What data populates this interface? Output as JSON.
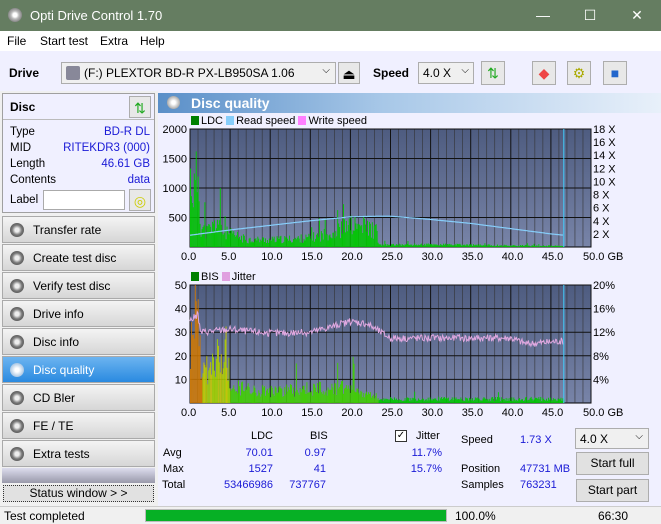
{
  "window": {
    "title": "Opti Drive Control 1.70",
    "minimize": "—",
    "maximize": "☐",
    "close": "✕"
  },
  "menu": [
    "File",
    "Start test",
    "Extra",
    "Help"
  ],
  "toolbar": {
    "drive_label": "Drive",
    "drive_value": "(F:)  PLEXTOR BD-R  PX-LB950SA 1.06",
    "speed_label": "Speed",
    "speed_value": "4.0 X"
  },
  "disc": {
    "title": "Disc",
    "type_label": "Type",
    "type": "BD-R DL",
    "mid_label": "MID",
    "mid": "RITEKDR3 (000)",
    "length_label": "Length",
    "length": "46.61 GB",
    "contents_label": "Contents",
    "contents": "data",
    "label_label": "Label",
    "label_value": ""
  },
  "nav": [
    {
      "label": "Transfer rate"
    },
    {
      "label": "Create test disc"
    },
    {
      "label": "Verify test disc"
    },
    {
      "label": "Drive info"
    },
    {
      "label": "Disc info"
    },
    {
      "label": "Disc quality",
      "active": true
    },
    {
      "label": "CD Bler"
    },
    {
      "label": "FE / TE"
    },
    {
      "label": "Extra tests"
    }
  ],
  "status_window": "Status window > >",
  "panel_title": "Disc quality",
  "chart_data": [
    {
      "type": "bar",
      "title": "LDC",
      "legend": [
        "LDC",
        "Read speed",
        "Write speed"
      ],
      "legend_colors": [
        "#008000",
        "#87cefa",
        "#ff80ff"
      ],
      "x_ticks": [
        "0.0",
        "5.0",
        "10.0",
        "15.0",
        "20.0",
        "25.0",
        "30.0",
        "35.0",
        "40.0",
        "45.0",
        "50.0 GB"
      ],
      "y_ticks": [
        "2000",
        "1500",
        "1000",
        "500"
      ],
      "y2_ticks": [
        "18 X",
        "16 X",
        "14 X",
        "12 X",
        "10 X",
        "8 X",
        "6 X",
        "4 X",
        "2 X"
      ],
      "xlim": [
        0,
        50
      ],
      "ylim": [
        0,
        2000
      ],
      "y2lim": [
        0,
        18
      ],
      "end_marker_gb": 46.61,
      "ldc_profile": [
        [
          0,
          1350
        ],
        [
          0.5,
          1100
        ],
        [
          1,
          1527
        ],
        [
          1.3,
          400
        ],
        [
          2,
          300
        ],
        [
          3,
          420
        ],
        [
          3.3,
          560
        ],
        [
          4,
          300
        ],
        [
          5,
          250
        ],
        [
          7,
          150
        ],
        [
          10,
          140
        ],
        [
          13,
          160
        ],
        [
          15,
          180
        ],
        [
          18,
          300
        ],
        [
          20,
          420
        ],
        [
          22,
          400
        ],
        [
          23.3,
          300
        ],
        [
          23.5,
          40
        ],
        [
          30,
          50
        ],
        [
          40,
          30
        ],
        [
          46.6,
          20
        ]
      ],
      "read_speed": [
        [
          0,
          1.8
        ],
        [
          5,
          2.6
        ],
        [
          10,
          3.3
        ],
        [
          15,
          4.0
        ],
        [
          20,
          4.6
        ],
        [
          23.5,
          4.7
        ],
        [
          25,
          4.7
        ],
        [
          30,
          4.2
        ],
        [
          35,
          3.6
        ],
        [
          40,
          2.8
        ],
        [
          45,
          2.0
        ],
        [
          46.6,
          1.8
        ]
      ]
    },
    {
      "type": "bar",
      "title": "BIS",
      "legend": [
        "BIS",
        "Jitter"
      ],
      "legend_colors": [
        "#008000",
        "#e0a0e0"
      ],
      "x_ticks": [
        "0.0",
        "5.0",
        "10.0",
        "15.0",
        "20.0",
        "25.0",
        "30.0",
        "35.0",
        "40.0",
        "45.0",
        "50.0 GB"
      ],
      "y_ticks": [
        "50",
        "40",
        "30",
        "20",
        "10"
      ],
      "y2_ticks": [
        "20%",
        "16%",
        "12%",
        "8%",
        "4%"
      ],
      "xlim": [
        0,
        50
      ],
      "ylim": [
        0,
        50
      ],
      "y2lim": [
        0,
        20
      ],
      "bis_profile": [
        [
          0,
          28
        ],
        [
          1,
          41
        ],
        [
          1.3,
          14
        ],
        [
          3,
          18
        ],
        [
          3.6,
          24
        ],
        [
          4,
          16
        ],
        [
          4.5,
          27
        ],
        [
          5,
          8
        ],
        [
          10,
          6
        ],
        [
          15,
          7
        ],
        [
          20,
          8
        ],
        [
          23.5,
          2
        ],
        [
          30,
          2
        ],
        [
          40,
          2
        ],
        [
          46.6,
          2
        ]
      ],
      "jitter": [
        [
          0,
          14
        ],
        [
          1,
          15
        ],
        [
          1.3,
          12
        ],
        [
          5,
          12.5
        ],
        [
          10,
          11.8
        ],
        [
          15,
          12
        ],
        [
          20,
          13.8
        ],
        [
          22,
          13.5
        ],
        [
          25,
          11
        ],
        [
          30,
          11
        ],
        [
          35,
          11
        ],
        [
          40,
          11
        ],
        [
          42,
          10
        ],
        [
          46.6,
          10.5
        ]
      ]
    }
  ],
  "stats": {
    "col_ldc": "LDC",
    "col_bis": "BIS",
    "jitter_label": "Jitter",
    "jitter_checked": true,
    "avg_label": "Avg",
    "avg_ldc": "70.01",
    "avg_bis": "0.97",
    "avg_jitter": "11.7%",
    "max_label": "Max",
    "max_ldc": "1527",
    "max_bis": "41",
    "max_jitter": "15.7%",
    "total_label": "Total",
    "total_ldc": "53466986",
    "total_bis": "737767",
    "speed_label": "Speed",
    "speed": "1.73 X",
    "position_label": "Position",
    "position": "47731 MB",
    "samples_label": "Samples",
    "samples": "763231",
    "speed_select": "4.0 X",
    "start_full": "Start full",
    "start_part": "Start part"
  },
  "statusbar": {
    "text": "Test completed",
    "progress": 100.0,
    "progress_text": "100.0%",
    "time": "66:30"
  }
}
